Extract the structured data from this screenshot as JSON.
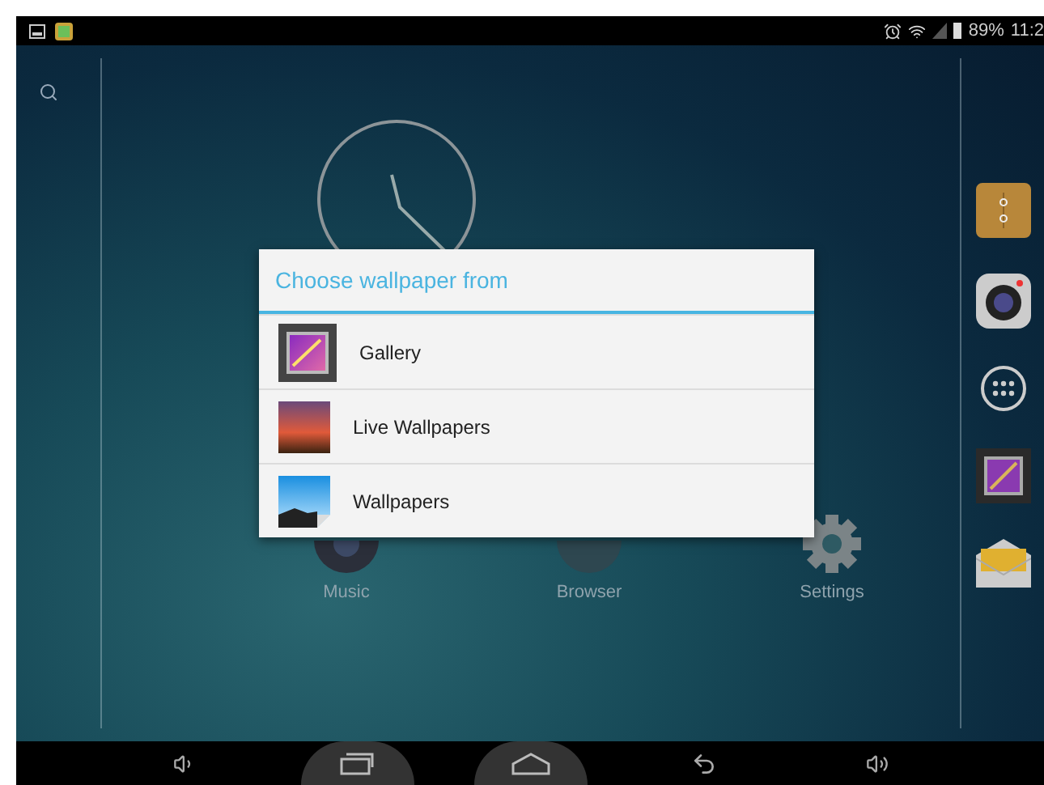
{
  "status_bar": {
    "battery": "89%",
    "time": "11:2"
  },
  "apps": [
    {
      "label": "Music",
      "kind": "music"
    },
    {
      "label": "Browser",
      "kind": "browser"
    },
    {
      "label": "Settings",
      "kind": "settings"
    }
  ],
  "dialog": {
    "title": "Choose wallpaper from",
    "options": [
      {
        "label": "Gallery",
        "kind": "gallery"
      },
      {
        "label": "Live Wallpapers",
        "kind": "live"
      },
      {
        "label": "Wallpapers",
        "kind": "wallpapers"
      }
    ]
  }
}
